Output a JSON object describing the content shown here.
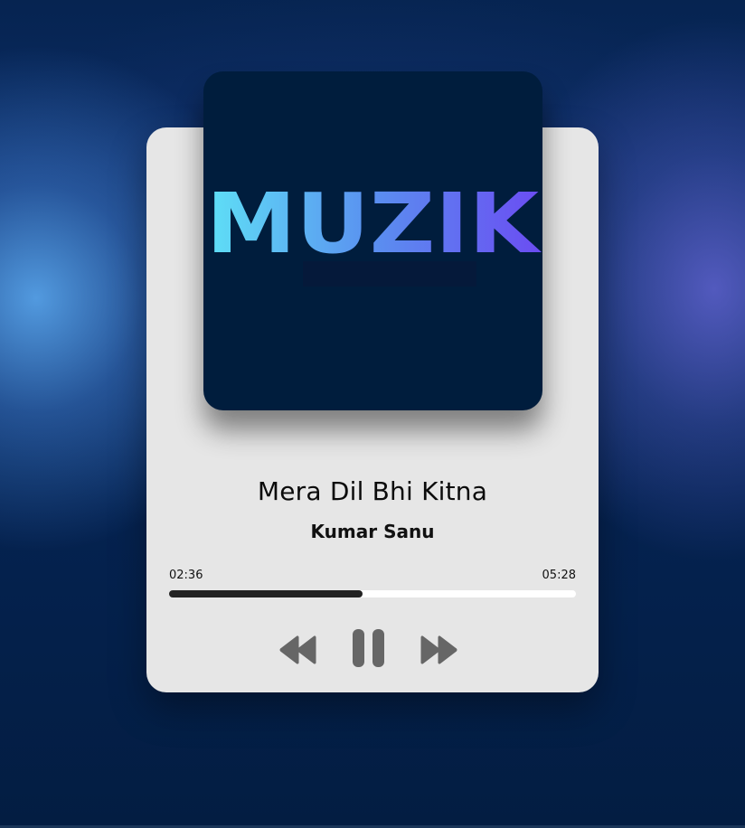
{
  "album": {
    "logo_text": "MUZIK",
    "background_color": "#001d3d",
    "logo_gradient": [
      "#5fd9f5",
      "#5b8ef0",
      "#6c4ef2"
    ]
  },
  "track": {
    "title": "Mera Dil Bhi Kitna",
    "artist": "Kumar Sanu"
  },
  "progress": {
    "current_time": "02:36",
    "total_time": "05:28",
    "fraction": 0.4756
  },
  "controls": {
    "previous_icon": "rewind-icon",
    "play_state_icon": "pause-icon",
    "next_icon": "fast-forward-icon"
  },
  "colors": {
    "card": "#e6e6e6",
    "progress_track": "#ffffff",
    "progress_fill": "#222222",
    "control_icons": "#666666"
  }
}
